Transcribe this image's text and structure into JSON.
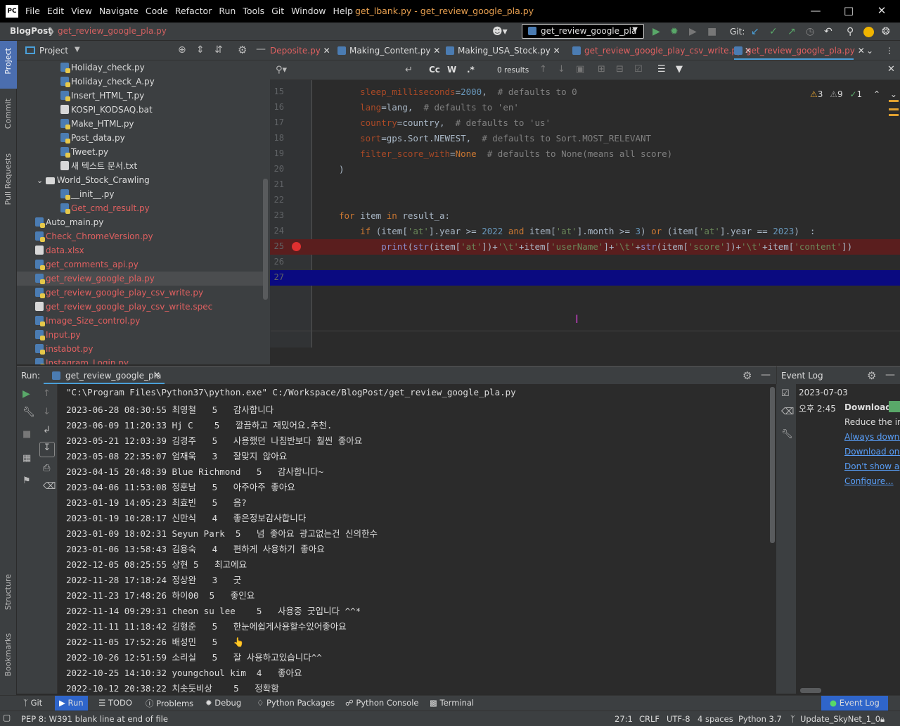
{
  "titlebar": {
    "logo": "PC",
    "menu": [
      "File",
      "Edit",
      "View",
      "Navigate",
      "Code",
      "Refactor",
      "Run",
      "Tools",
      "Git",
      "Window",
      "Help"
    ],
    "title": "get_lbank.py - get_review_google_pla.py"
  },
  "navbar": {
    "project": "BlogPost",
    "file": "get_review_google_pla.py",
    "run_config": "get_review_google_pla",
    "git_label": "Git:"
  },
  "sidebar": {
    "project": "Project",
    "commit": "Commit",
    "pull_requests": "Pull Requests",
    "structure": "Structure",
    "bookmarks": "Bookmarks"
  },
  "project_panel": {
    "title": "Project",
    "tree": [
      {
        "label": "Holiday_check.py",
        "indent": 3,
        "type": "py",
        "red": false
      },
      {
        "label": "Holiday_check_A.py",
        "indent": 3,
        "type": "py",
        "red": false
      },
      {
        "label": "Insert_HTML_T.py",
        "indent": 3,
        "type": "py",
        "red": false
      },
      {
        "label": "KOSPI_KODSAQ.bat",
        "indent": 3,
        "type": "txt",
        "red": false
      },
      {
        "label": "Make_HTML.py",
        "indent": 3,
        "type": "py",
        "red": false
      },
      {
        "label": "Post_data.py",
        "indent": 3,
        "type": "py",
        "red": false
      },
      {
        "label": "Tweet.py",
        "indent": 3,
        "type": "py",
        "red": false
      },
      {
        "label": "새 텍스트 문서.txt",
        "indent": 3,
        "type": "txt",
        "red": false
      },
      {
        "label": "World_Stock_Crawling",
        "indent": 2,
        "type": "folder",
        "red": false
      },
      {
        "label": "__init__.py",
        "indent": 3,
        "type": "py",
        "red": false
      },
      {
        "label": "Get_cmd_result.py",
        "indent": 3,
        "type": "py",
        "red": true
      },
      {
        "label": "Auto_main.py",
        "indent": 1,
        "type": "py",
        "red": false
      },
      {
        "label": "Check_ChromeVersion.py",
        "indent": 1,
        "type": "py",
        "red": true
      },
      {
        "label": "data.xlsx",
        "indent": 1,
        "type": "txt",
        "red": true
      },
      {
        "label": "get_comments_api.py",
        "indent": 1,
        "type": "py",
        "red": true
      },
      {
        "label": "get_review_google_pla.py",
        "indent": 1,
        "type": "py",
        "red": true,
        "selected": true
      },
      {
        "label": "get_review_google_play_csv_write.py",
        "indent": 1,
        "type": "py",
        "red": true
      },
      {
        "label": "get_review_google_play_csv_write.spec",
        "indent": 1,
        "type": "txt",
        "red": true
      },
      {
        "label": "Image_Size_control.py",
        "indent": 1,
        "type": "py",
        "red": true
      },
      {
        "label": "Input.py",
        "indent": 1,
        "type": "py",
        "red": true
      },
      {
        "label": "instabot.py",
        "indent": 1,
        "type": "py",
        "red": true
      },
      {
        "label": "Instagram_Login.py",
        "indent": 1,
        "type": "py",
        "red": true
      }
    ]
  },
  "editor_tabs": [
    {
      "label": "Deposite.py",
      "red": true,
      "active": false
    },
    {
      "label": "Making_Content.py",
      "red": false,
      "active": false
    },
    {
      "label": "Making_USA_Stock.py",
      "red": false,
      "active": false
    },
    {
      "label": "get_review_google_play_csv_write.py",
      "red": true,
      "active": false
    },
    {
      "label": "get_review_google_pla.py",
      "red": true,
      "active": true
    }
  ],
  "search": {
    "results": "0 results",
    "case": "Cc",
    "word": "W",
    "regex": ".*"
  },
  "inspections": {
    "warnings": "3",
    "weak_warnings": "9",
    "typos": "1"
  },
  "editor": {
    "line_numbers": [
      "15",
      "16",
      "17",
      "18",
      "19",
      "20",
      "21",
      "22",
      "23",
      "24",
      "25",
      "26",
      "27"
    ]
  },
  "run_panel": {
    "label": "Run:",
    "tab": "get_review_google_pla",
    "command": "\"C:\\Program Files\\Python37\\python.exe\" C:/Workspace/BlogPost/get_review_google_pla.py",
    "lines": [
      "2023-06-28 08:30:55 최영철   5   감사합니다",
      "2023-06-09 11:20:33 Hj C    5   깔끔하고 재밌어요.추천.",
      "2023-05-21 12:03:39 김경주   5   사용했던 나침반보다 훨씬 좋아요",
      "2023-05-08 22:35:07 엄재욱   3   잘맞지 않아요",
      "2023-04-15 20:48:39 Blue Richmond   5   감사합니다~",
      "2023-04-06 11:53:08 정훈남   5   아주아주 좋아요",
      "2023-01-19 14:05:23 최효빈   5   음?",
      "2023-01-19 10:28:17 신만식   4   좋은정보감사합니다",
      "2023-01-09 18:02:31 Seyun Park  5   넘 좋아요 광고없는건 신의한수",
      "2023-01-06 13:58:43 김용숙   4   편하게 사용하기 좋아요",
      "2022-12-05 08:25:55 상현 5   최고에요",
      "2022-11-28 17:18:24 정상완   3   굿",
      "2022-11-23 17:48:26 하이00  5   좋인요",
      "2022-11-14 09:29:31 cheon su lee    5   사용중 굿입니다 ^^*",
      "2022-11-11 11:18:42 김형준   5   한눈에쉽게사용할수있어좋아요",
      "2022-11-05 17:52:26 배성민   5   👆",
      "2022-10-26 12:51:59 소리실   5   잘 사용하고있습니다^^",
      "2022-10-25 14:10:32 youngchoul kim  4   좋아요",
      "2022-10-12 20:38:22 치솟듯비상    5   정확함"
    ]
  },
  "event_log": {
    "title": "Event Log",
    "date": "2023-07-03",
    "time": "오후 2:45",
    "heading": "Download",
    "text": "Reduce the ind",
    "links": [
      "Always downlo",
      "Download once",
      "Don't show ag",
      "Configure..."
    ]
  },
  "toolwindows": [
    "Git",
    "Run",
    "TODO",
    "Problems",
    "Debug",
    "Python Packages",
    "Python Console",
    "Terminal",
    "Event Log"
  ],
  "status": {
    "message": "PEP 8: W391 blank line at end of file",
    "position": "27:1",
    "line_sep": "CRLF",
    "encoding": "UTF-8",
    "indent": "4 spaces",
    "interpreter": "Python 3.7",
    "branch": "Update_SkyNet_1_0"
  }
}
